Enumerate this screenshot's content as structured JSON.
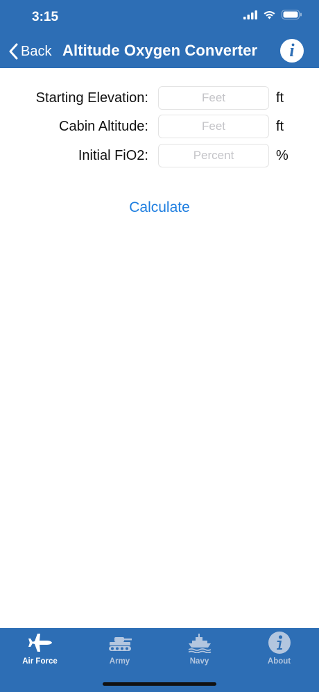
{
  "status": {
    "time": "3:15"
  },
  "nav": {
    "back_label": "Back",
    "title": "Altitude Oxygen Converter",
    "info_glyph": "i"
  },
  "form": {
    "rows": [
      {
        "label": "Starting Elevation:",
        "placeholder": "Feet",
        "value": "",
        "unit": "ft"
      },
      {
        "label": "Cabin Altitude:",
        "placeholder": "Feet",
        "value": "",
        "unit": "ft"
      },
      {
        "label": "Initial FiO2:",
        "placeholder": "Percent",
        "value": "",
        "unit": "%"
      }
    ],
    "calculate_label": "Calculate"
  },
  "tabs": [
    {
      "label": "Air Force",
      "icon": "jet-icon",
      "active": true
    },
    {
      "label": "Army",
      "icon": "tank-icon",
      "active": false
    },
    {
      "label": "Navy",
      "icon": "ship-icon",
      "active": false
    },
    {
      "label": "About",
      "icon": "info-icon",
      "active": false
    }
  ],
  "colors": {
    "bar": "#2d6eb5",
    "accent": "#1e7ee0",
    "tab_inactive": "#b3c6df"
  }
}
